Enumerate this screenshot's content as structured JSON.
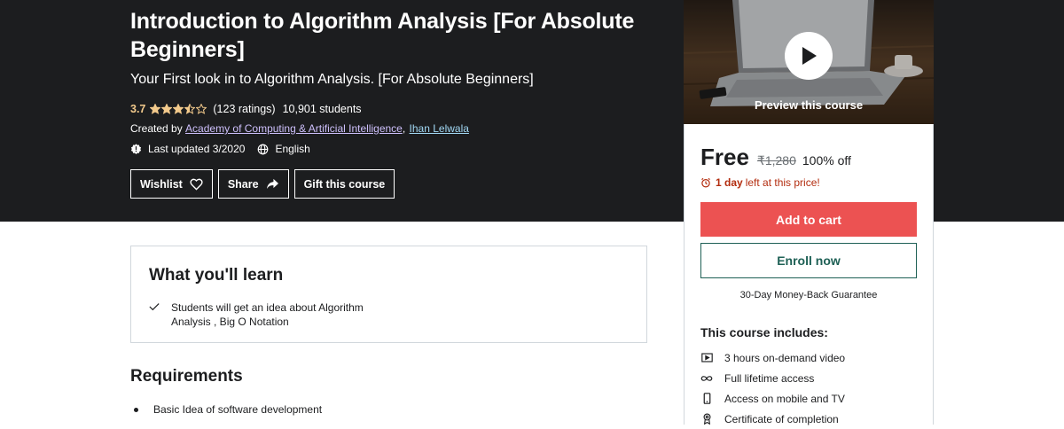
{
  "course": {
    "title": "Introduction to Algorithm Analysis [For Absolute Beginners]",
    "subtitle": "Your First look in to Algorithm Analysis. [For Absolute Beginners]",
    "rating": "3.7",
    "rating_value": 3.7,
    "ratings_count": "(123 ratings)",
    "students": "10,901 students",
    "created_by_label": "Created by",
    "instructors": [
      "Academy of Computing & Artificial Intelligence",
      "Ihan Lelwala"
    ],
    "last_updated": "Last updated 3/2020",
    "language": "English"
  },
  "actions": {
    "wishlist": "Wishlist",
    "share": "Share",
    "gift": "Gift this course"
  },
  "preview": {
    "label": "Preview this course"
  },
  "purchase": {
    "price": "Free",
    "original_price": "₹1,280",
    "discount": "100% off",
    "timer_bold": "1 day",
    "timer_rest": "left at this price!",
    "add_to_cart": "Add to cart",
    "enroll": "Enroll now",
    "guarantee": "30-Day Money-Back Guarantee",
    "includes_title": "This course includes:",
    "includes": [
      {
        "icon": "video-icon",
        "label": "3 hours on-demand video"
      },
      {
        "icon": "infinity-icon",
        "label": "Full lifetime access"
      },
      {
        "icon": "mobile-icon",
        "label": "Access on mobile and TV"
      },
      {
        "icon": "certificate-icon",
        "label": "Certificate of completion"
      }
    ]
  },
  "learn": {
    "title": "What you'll learn",
    "items": [
      "Students will get an idea about Algorithm Analysis , Big O Notation"
    ]
  },
  "requirements": {
    "title": "Requirements",
    "items": [
      "Basic Idea of software development"
    ]
  },
  "colors": {
    "hero_bg": "#1c1d1f",
    "star": "#f3ca8c",
    "cart_button": "#ec5252",
    "enroll_border": "#1e6055",
    "timer": "#b32d0f"
  }
}
